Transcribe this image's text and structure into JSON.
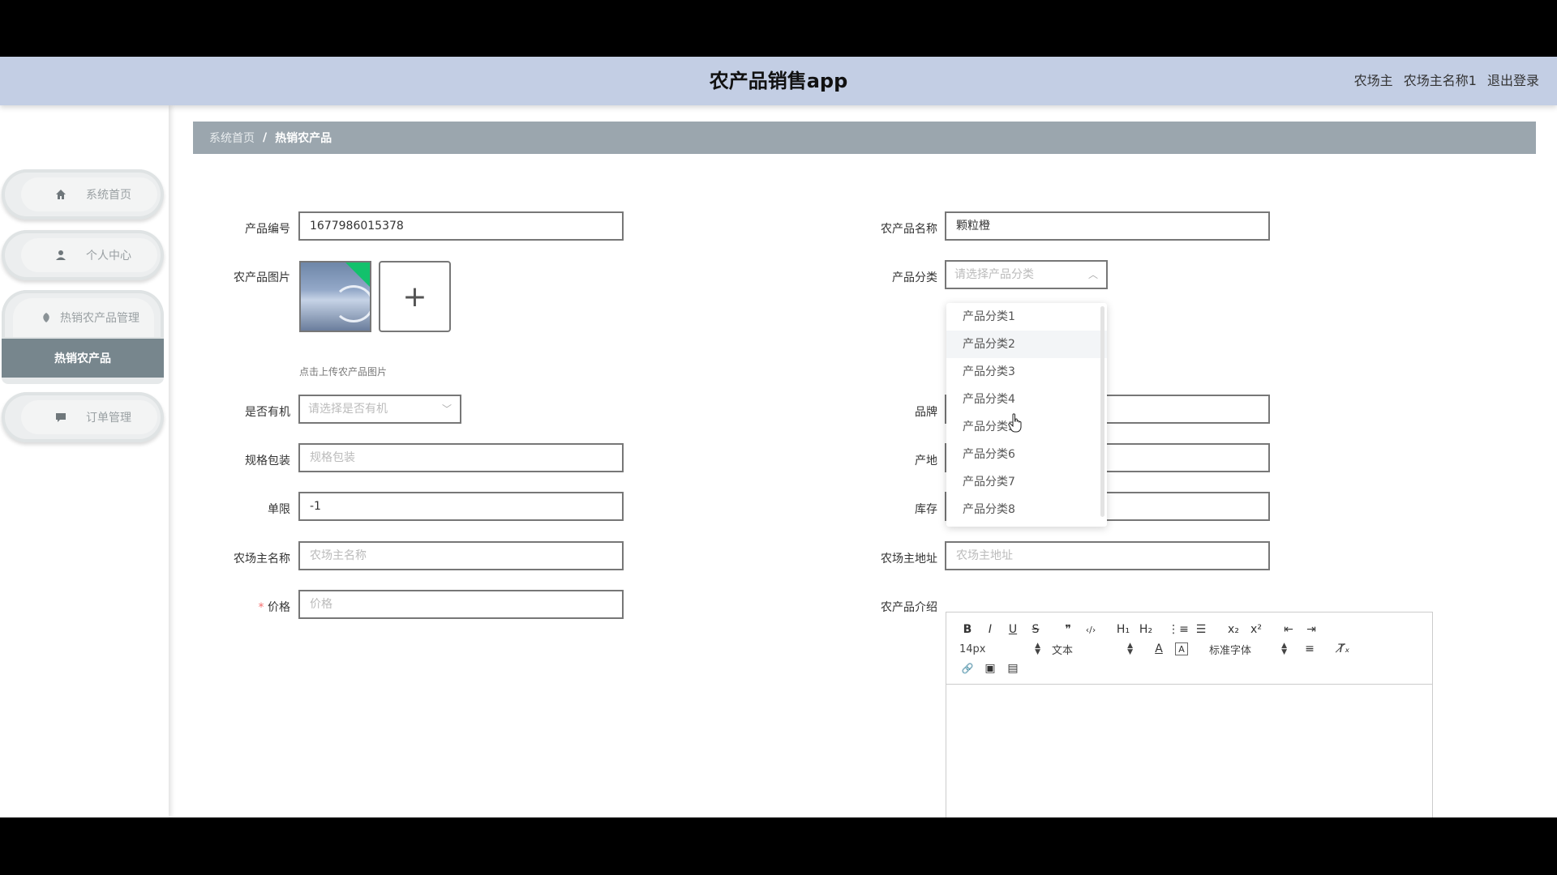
{
  "header": {
    "title": "农产品销售app",
    "role": "农场主",
    "username": "农场主名称1",
    "logout": "退出登录"
  },
  "sidebar": {
    "items": [
      {
        "label": "系统首页",
        "icon": "home-icon"
      },
      {
        "label": "个人中心",
        "icon": "user-icon"
      },
      {
        "label": "热销农产品管理",
        "icon": "leaf-icon"
      },
      {
        "label": "订单管理",
        "icon": "chat-icon"
      }
    ],
    "submenu": {
      "label": "热销农产品"
    }
  },
  "breadcrumb": {
    "home": "系统首页",
    "separator": "/",
    "current": "热销农产品"
  },
  "form": {
    "product_no": {
      "label": "产品编号",
      "value": "1677986015378"
    },
    "product_name": {
      "label": "农产品名称",
      "value": "颗粒橙"
    },
    "image": {
      "label": "农产品图片",
      "tip": "点击上传农产品图片",
      "add": "+"
    },
    "category": {
      "label": "产品分类",
      "placeholder": "请选择产品分类"
    },
    "organic": {
      "label": "是否有机",
      "placeholder": "请选择是否有机"
    },
    "brand": {
      "label": "品牌"
    },
    "package": {
      "label": "规格包装",
      "placeholder": "规格包装"
    },
    "origin": {
      "label": "产地"
    },
    "limit": {
      "label": "单限",
      "value": "-1"
    },
    "stock": {
      "label": "库存"
    },
    "farmer_name": {
      "label": "农场主名称",
      "placeholder": "农场主名称"
    },
    "farmer_addr": {
      "label": "农场主地址",
      "placeholder": "农场主地址"
    },
    "price": {
      "required": "*",
      "label": "价格",
      "placeholder": "价格"
    },
    "intro": {
      "label": "农产品介绍"
    }
  },
  "category_options": [
    "产品分类1",
    "产品分类2",
    "产品分类3",
    "产品分类4",
    "产品分类5",
    "产品分类6",
    "产品分类7",
    "产品分类8"
  ],
  "editor": {
    "row1": [
      "B",
      "I",
      "U",
      "S",
      "❞",
      "‹/›",
      "H₁",
      "H₂",
      "⋮≡",
      "☰",
      "x₂",
      "x²",
      "⇤",
      "⇥"
    ],
    "font_size": "14px",
    "block_type": "文本",
    "font_family": "标准字体",
    "align": "≡",
    "clear": "T̸ₓ",
    "row3": [
      "🔗",
      "▣",
      "▤"
    ]
  },
  "colors": {
    "header_bg": "#c3cee4",
    "breadcrumb_bg": "#9ba6ae",
    "active_submenu": "#77868d",
    "upload_corner": "#13c16c"
  }
}
